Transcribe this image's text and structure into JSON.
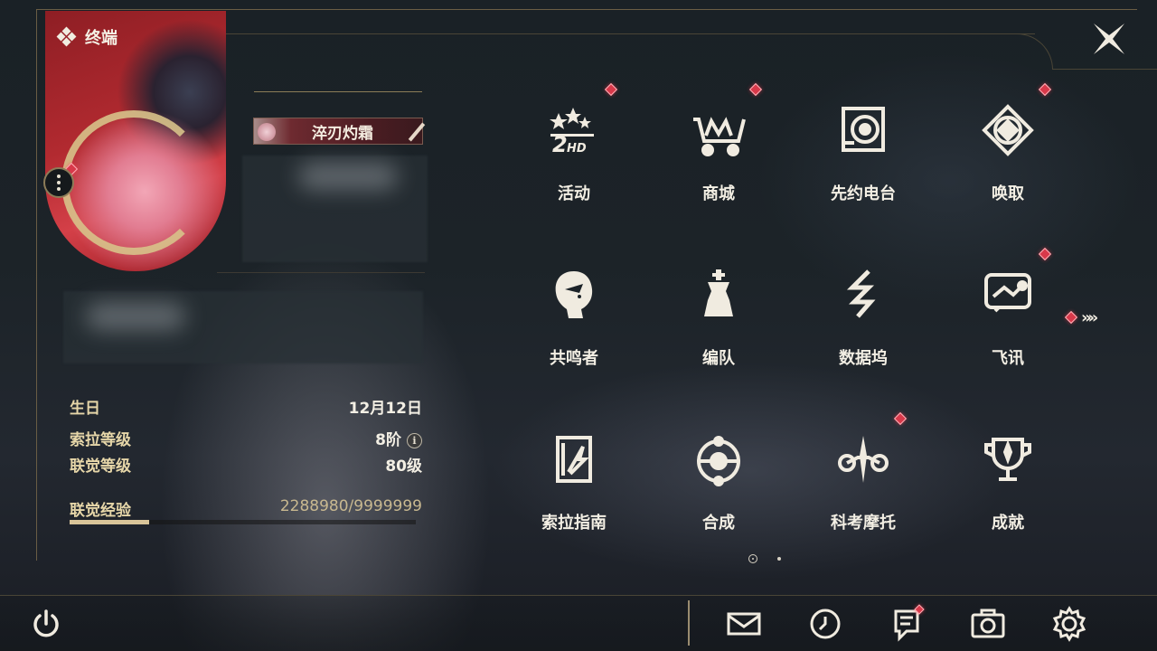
{
  "header": {
    "title": "终端"
  },
  "profile": {
    "title_badge": "淬刃灼霜",
    "birthday_label": "生日",
    "birthday_value": "12月12日",
    "sola_level_label": "索拉等级",
    "sola_level_value": "8阶",
    "union_level_label": "联觉等级",
    "union_level_value": "80级",
    "union_exp_label": "联觉经验",
    "union_exp_value": "2288980/9999999",
    "union_exp_progress": 0.2289,
    "info_icon": "i"
  },
  "menu": {
    "items": [
      {
        "label": "活动",
        "icon": "events-icon",
        "badge": true
      },
      {
        "label": "商城",
        "icon": "shop-cart-icon",
        "badge": true
      },
      {
        "label": "先约电台",
        "icon": "radio-icon",
        "badge": false
      },
      {
        "label": "唤取",
        "icon": "convene-icon",
        "badge": true
      },
      {
        "label": "共鸣者",
        "icon": "resonator-icon",
        "badge": false
      },
      {
        "label": "编队",
        "icon": "chess-team-icon",
        "badge": false
      },
      {
        "label": "数据坞",
        "icon": "data-bank-icon",
        "badge": false
      },
      {
        "label": "飞讯",
        "icon": "message-icon",
        "badge": true
      },
      {
        "label": "索拉指南",
        "icon": "guidebook-icon",
        "badge": false
      },
      {
        "label": "合成",
        "icon": "synthesis-icon",
        "badge": false
      },
      {
        "label": "科考摩托",
        "icon": "motorcycle-icon",
        "badge": true
      },
      {
        "label": "成就",
        "icon": "trophy-icon",
        "badge": false
      }
    ],
    "next_page_glyph": "»»",
    "page_count": 2,
    "current_page": 1
  },
  "bottom_bar": {
    "power": "power-icon",
    "tools": [
      "mail-icon",
      "clock-icon",
      "notice-icon",
      "camera-icon",
      "gear-icon"
    ]
  },
  "colors": {
    "accent_gold": "#d9c499",
    "badge_red": "#d8394a",
    "label_gold": "#e6d6a8"
  }
}
